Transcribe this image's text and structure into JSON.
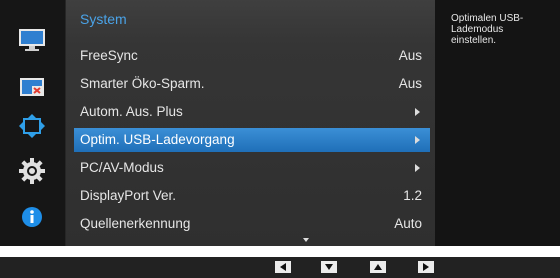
{
  "menu": {
    "title": "System",
    "items": [
      {
        "label": "FreeSync",
        "value": "Aus"
      },
      {
        "label": "Smarter Öko-Sparm.",
        "value": "Aus"
      },
      {
        "label": "Autom. Aus. Plus",
        "value": ""
      },
      {
        "label": "Optim. USB-Ladevorgang",
        "value": ""
      },
      {
        "label": "PC/AV-Modus",
        "value": ""
      },
      {
        "label": "DisplayPort Ver.",
        "value": "1.2"
      },
      {
        "label": "Quellenerkennung",
        "value": "Auto"
      }
    ]
  },
  "help": {
    "text": "Optimalen USB-Lademodus einstellen."
  },
  "sidebar": [
    "monitor-icon",
    "picture-in-picture-icon",
    "resize-arrows-icon",
    "gear-icon",
    "info-icon"
  ],
  "navigation": [
    "left-arrow-icon",
    "down-arrow-icon",
    "up-arrow-icon",
    "right-arrow-icon"
  ],
  "colors": {
    "accent": "#3b8fd6",
    "title": "#4aa3e8"
  }
}
